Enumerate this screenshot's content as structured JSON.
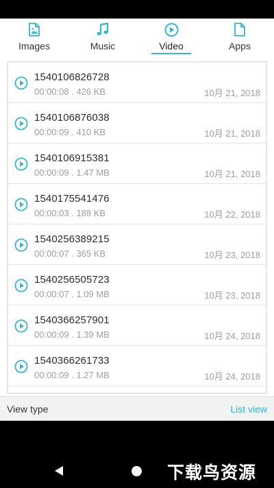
{
  "tabs": [
    {
      "label": "Images",
      "icon": "image-file-icon",
      "active": false
    },
    {
      "label": "Music",
      "icon": "music-note-icon",
      "active": false
    },
    {
      "label": "Video",
      "icon": "play-circle-icon",
      "active": true
    },
    {
      "label": "Apps",
      "icon": "document-icon",
      "active": false
    }
  ],
  "videos": [
    {
      "name": "1540106826728",
      "meta": "00:00:08 . 426 KB",
      "date": "10月 21, 2018"
    },
    {
      "name": "1540106876038",
      "meta": "00:00:09 . 410 KB",
      "date": "10月 21, 2018"
    },
    {
      "name": "1540106915381",
      "meta": "00:00:09 . 1.47 MB",
      "date": "10月 21, 2018"
    },
    {
      "name": "1540175541476",
      "meta": "00:00:03 . 188 KB",
      "date": "10月 22, 2018"
    },
    {
      "name": "1540256389215",
      "meta": "00:00:07 . 365 KB",
      "date": "10月 23, 2018"
    },
    {
      "name": "1540256505723",
      "meta": "00:00:07 . 1.09 MB",
      "date": "10月 23, 2018"
    },
    {
      "name": "1540366257901",
      "meta": "00:00:09 . 1.39 MB",
      "date": "10月 24, 2018"
    },
    {
      "name": "1540366261733",
      "meta": "00:00:09 . 1.27 MB",
      "date": "10月 24, 2018"
    }
  ],
  "view_type": {
    "label": "View type",
    "value": "List view"
  },
  "watermark": "下载鸟资源",
  "colors": {
    "accent": "#2eb8d4",
    "text": "#2b2b2b",
    "secondary": "#9e9e9e"
  }
}
